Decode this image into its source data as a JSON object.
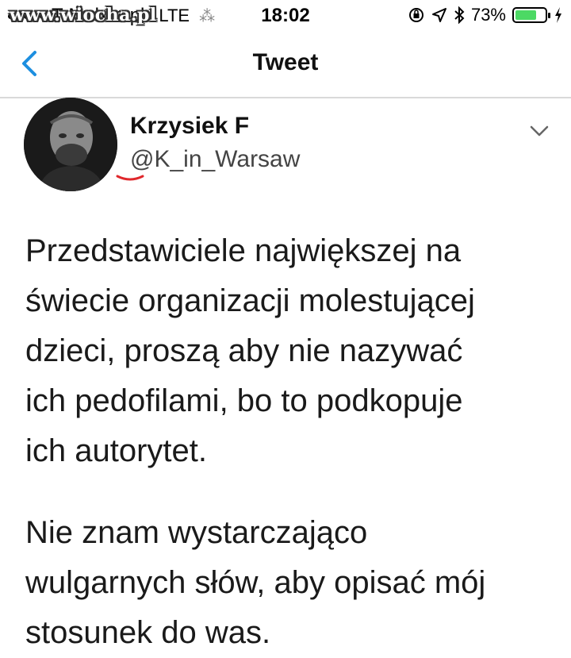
{
  "status_bar": {
    "carrier": "T-Mobile.pl",
    "network": "LTE",
    "time": "18:02",
    "battery_percent_label": "73%",
    "battery_level": 0.73,
    "battery_color": "#4cd964",
    "icons": [
      "orientation-lock-icon",
      "location-icon",
      "bluetooth-icon",
      "charging-icon"
    ]
  },
  "watermark": "www.wiocha.pl",
  "nav": {
    "title": "Tweet",
    "back_icon": "chevron-left-icon",
    "accent_color": "#1d8fe0"
  },
  "tweet": {
    "author_name": "Krzysiek F",
    "author_handle": "@K_in_Warsaw",
    "menu_icon": "chevron-down-icon",
    "paragraphs": [
      "Przedstawiciele największej na\nświecie organizacji molestującej\ndzieci, proszą aby nie nazywać\nich pedofilami, bo to podkopuje\nich autorytet.",
      "Nie znam wystarczająco\nwulgarnych słów, aby opisać mój\nstosunek do was."
    ]
  }
}
